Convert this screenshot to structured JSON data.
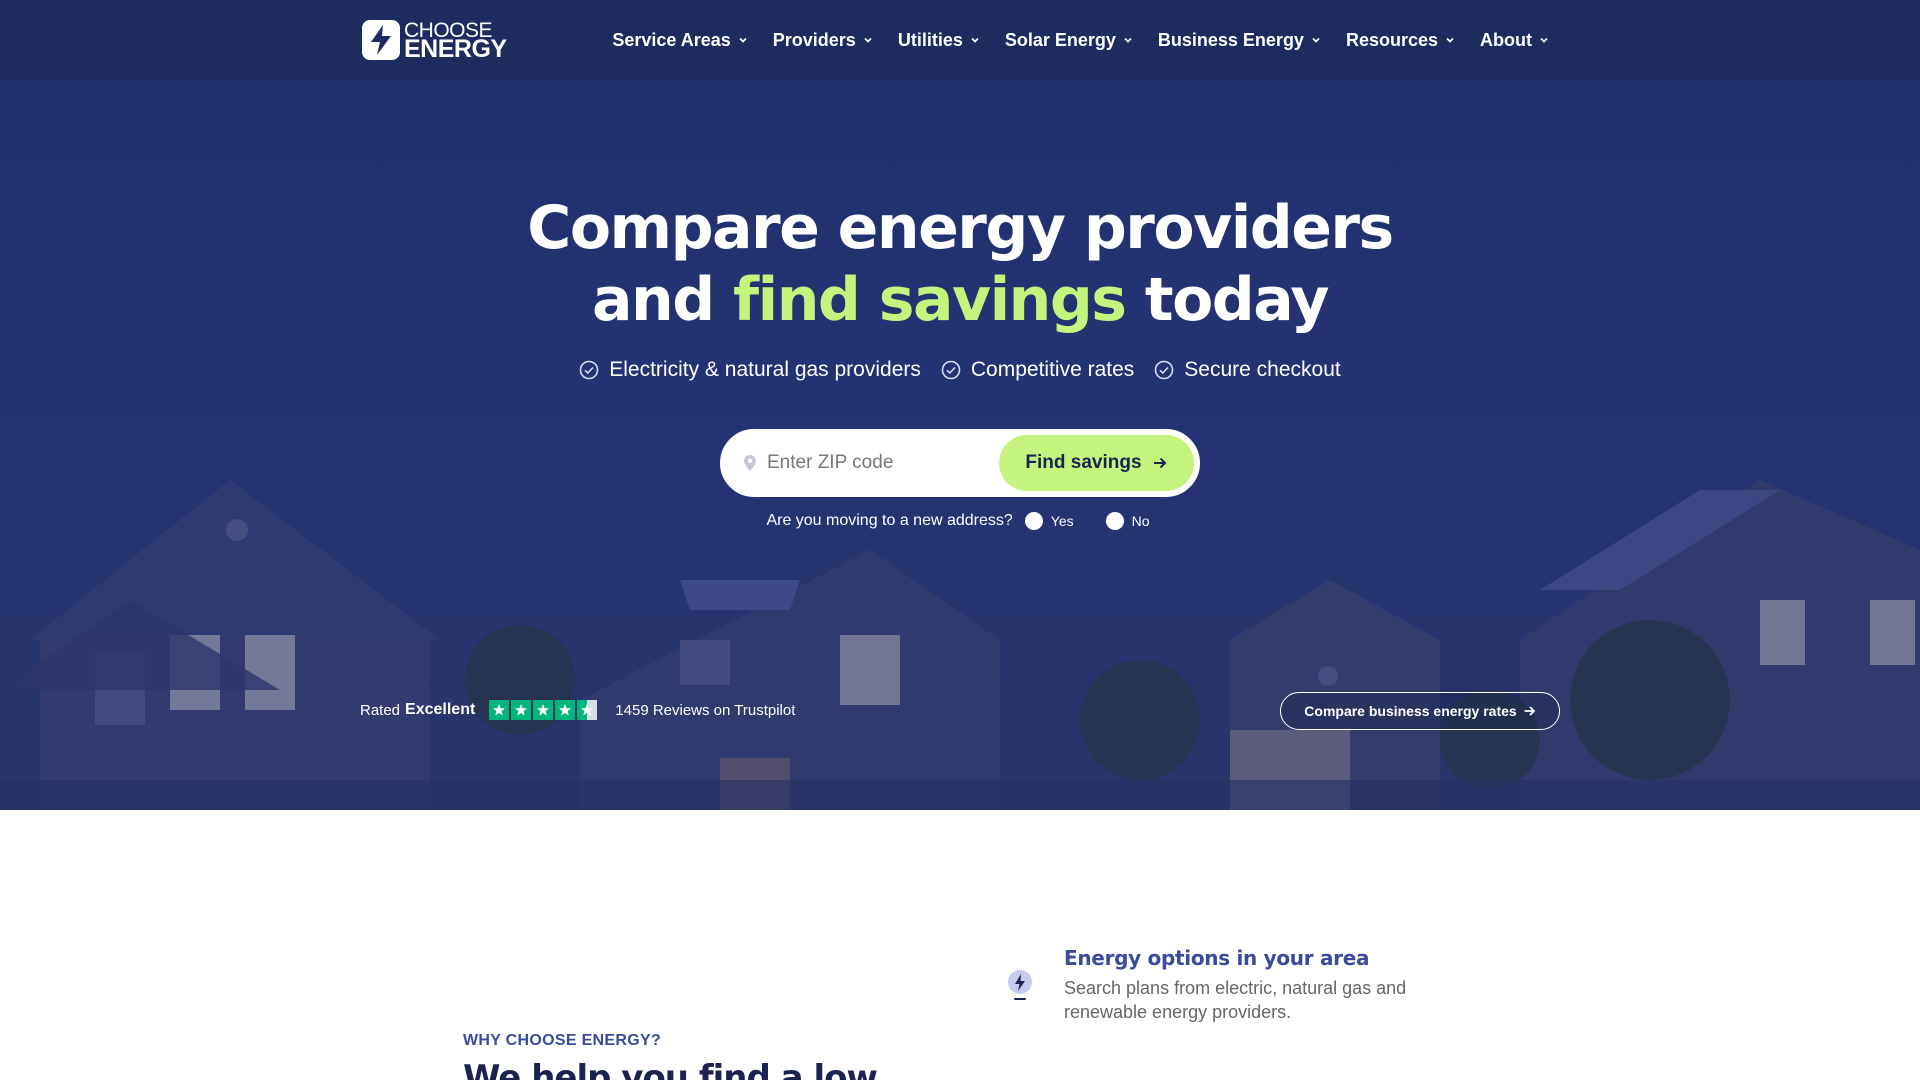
{
  "brand": {
    "line1": "CHOOSE",
    "line2": "ENERGY"
  },
  "nav": {
    "items": [
      {
        "label": "Service Areas"
      },
      {
        "label": "Providers"
      },
      {
        "label": "Utilities"
      },
      {
        "label": "Solar Energy"
      },
      {
        "label": "Business Energy"
      },
      {
        "label": "Resources"
      },
      {
        "label": "About"
      }
    ]
  },
  "hero": {
    "title_line1": "Compare energy providers",
    "title_line2_prefix": "and ",
    "title_line2_accent": "find savings",
    "title_line2_suffix": " today",
    "features": [
      "Electricity & natural gas providers",
      "Competitive rates",
      "Secure checkout"
    ],
    "search": {
      "placeholder": "Enter ZIP code",
      "button_label": "Find savings"
    },
    "moving": {
      "question": "Are you moving to a new address?",
      "yes": "Yes",
      "no": "No"
    },
    "rating": {
      "prefix": "Rated",
      "label": "Excellent",
      "stars": 4.5,
      "reviews": "1459 Reviews on Trustpilot"
    },
    "business_button": "Compare business energy rates"
  },
  "why": {
    "label": "WHY CHOOSE ENERGY?",
    "heading": "We help you find a low"
  },
  "option": {
    "title": "Energy options in your area",
    "desc": "Search plans from electric, natural gas and renewable energy providers."
  },
  "colors": {
    "header_bg": "#1e2b5e",
    "accent_green": "#c4f37e",
    "trustpilot_green": "#00b67a",
    "brand_blue": "#3b4a9a"
  }
}
